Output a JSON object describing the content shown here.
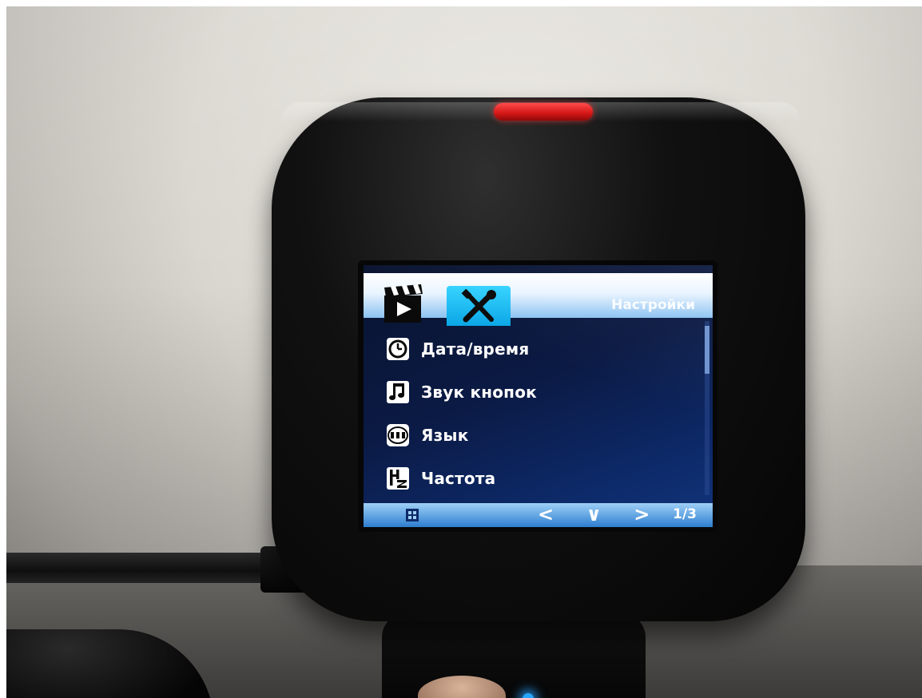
{
  "screen": {
    "header": {
      "title": "Настройки",
      "tabs": [
        {
          "name": "video-tab",
          "icon": "clapperboard-icon",
          "active": false
        },
        {
          "name": "settings-tab",
          "icon": "wrench-screwdriver-icon",
          "active": true
        }
      ]
    },
    "menu": {
      "items": [
        {
          "label": "Дата/время",
          "icon": "clock-icon"
        },
        {
          "label": "Звук кнопок",
          "icon": "music-note-icon"
        },
        {
          "label": "Язык",
          "icon": "abc-language-icon"
        },
        {
          "label": "Частота",
          "icon": "hz-icon"
        }
      ]
    },
    "footer": {
      "nav": "< ∨ >",
      "page": "1/3"
    }
  },
  "colors": {
    "record_button": "#d31616",
    "header_bar": "#e9f4ff",
    "active_tab": "#0aa6e6",
    "screen_background": "#0b1a44",
    "led": "#28a6ff"
  }
}
